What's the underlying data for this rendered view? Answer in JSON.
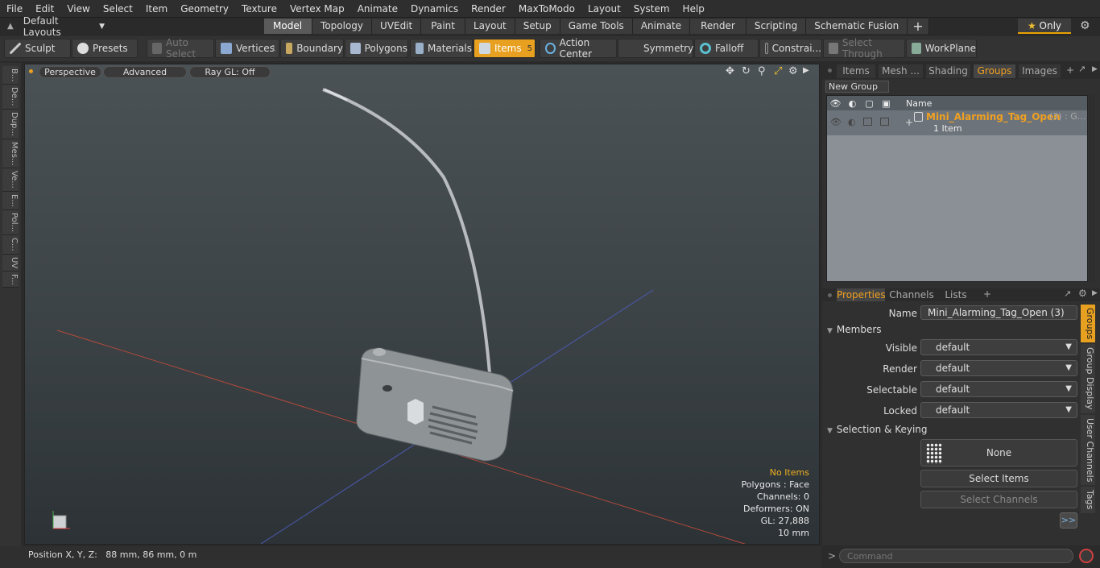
{
  "menu": [
    "File",
    "Edit",
    "View",
    "Select",
    "Item",
    "Geometry",
    "Texture",
    "Vertex Map",
    "Animate",
    "Dynamics",
    "Render",
    "MaxToModo",
    "Layout",
    "System",
    "Help"
  ],
  "layout": {
    "label": "Default Layouts",
    "only": "Only"
  },
  "mode_tabs": [
    "Model",
    "Topology",
    "UVEdit",
    "Paint",
    "Layout",
    "Setup",
    "Game Tools",
    "Animate",
    "Render",
    "Scripting",
    "Schematic Fusion"
  ],
  "active_tab": "Model",
  "toolbar": {
    "sculpt": "Sculpt",
    "presets": "Presets",
    "auto_select": "Auto Select",
    "vertices": "Vertices",
    "vertices_count": "1",
    "boundary": "Boundary",
    "polygons": "Polygons",
    "materials": "Materials",
    "items": "Items",
    "items_count": "5",
    "action_center": "Action Center",
    "symmetry": "Symmetry",
    "falloff": "Falloff",
    "constraints": "Constrai...",
    "select_through": "Select Through",
    "workplane": "WorkPlane"
  },
  "left_tabs": [
    "B...",
    "De...",
    "Dup...",
    "Mes...",
    "Ve...",
    "E...",
    "Pol...",
    "C...",
    "UV",
    "F..."
  ],
  "viewport": {
    "perspective": "Perspective",
    "advanced": "Advanced",
    "raygl": "Ray GL: Off",
    "stats": {
      "no_items": "No Items",
      "polygons": "Polygons : Face",
      "channels": "Channels: 0",
      "deformers": "Deformers: ON",
      "gl": "GL: 27,888",
      "scale": "10 mm"
    }
  },
  "status": {
    "position": "Position X, Y, Z:   88 mm, 86 mm, 0 m"
  },
  "right_tabs": [
    "Items",
    "Mesh ...",
    "Shading",
    "Groups",
    "Images"
  ],
  "active_right_tab": "Groups",
  "groups": {
    "new_group": "New Group",
    "name_header": "Name",
    "group_name": "Mini_Alarming_Tag_Open",
    "group_suffix": "(3) : G...",
    "group_items": "1 Item"
  },
  "prop_tabs": [
    "Properties",
    "Channels",
    "Lists"
  ],
  "properties": {
    "name_label": "Name",
    "name_value": "Mini_Alarming_Tag_Open (3)",
    "members": "Members",
    "visible_label": "Visible",
    "visible_value": "default",
    "render_label": "Render",
    "render_value": "default",
    "selectable_label": "Selectable",
    "selectable_value": "default",
    "locked_label": "Locked",
    "locked_value": "default",
    "selection_keying": "Selection & Keying",
    "none": "None",
    "select_items": "Select Items",
    "select_channels": "Select Channels",
    "more": ">>"
  },
  "side_tabs": [
    "Groups",
    "Group Display",
    "User Channels",
    "Tags"
  ],
  "command": {
    "placeholder": "Command"
  }
}
